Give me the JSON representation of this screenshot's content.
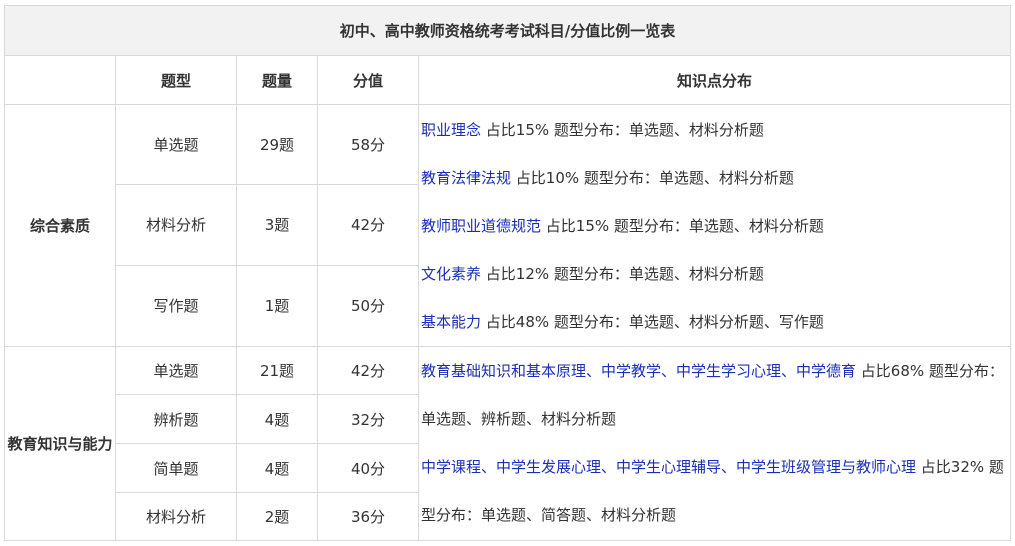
{
  "table": {
    "title": "初中、高中教师资格统考考试科目/分值比例一览表",
    "headers": [
      "",
      "题型",
      "题量",
      "分值",
      "知识点分布"
    ],
    "groups": [
      {
        "name": "综合素质",
        "rows": [
          {
            "type": "单选题",
            "count": "29题",
            "score": "58分"
          },
          {
            "type": "材料分析",
            "count": "3题",
            "score": "42分"
          },
          {
            "type": "写作题",
            "count": "1题",
            "score": "50分"
          }
        ],
        "knowledge": [
          {
            "link": "职业理念",
            "rest": " 占比15% 题型分布：单选题、材料分析题"
          },
          {
            "link": "教育法律法规",
            "rest": " 占比10% 题型分布：单选题、材料分析题"
          },
          {
            "link": "教师职业道德规范",
            "rest": " 占比15% 题型分布：单选题、材料分析题"
          },
          {
            "link": "文化素养",
            "rest": " 占比12% 题型分布：单选题、材料分析题"
          },
          {
            "link": "基本能力",
            "rest": " 占比48% 题型分布：单选题、材料分析题、写作题"
          }
        ]
      },
      {
        "name": "教育知识与能力",
        "rows": [
          {
            "type": "单选题",
            "count": "21题",
            "score": "42分"
          },
          {
            "type": "辨析题",
            "count": "4题",
            "score": "32分"
          },
          {
            "type": "简单题",
            "count": "4题",
            "score": "40分"
          },
          {
            "type": "材料分析",
            "count": "2题",
            "score": "36分"
          }
        ],
        "knowledge": [
          {
            "link": "教育基础知识和基本原理、中学教学、中学生学习心理、中学德育",
            "rest": " 占比68% 题型分布：单选题、辨析题、材料分析题"
          },
          {
            "link": "中学课程、中学生发展心理、中学生心理辅导、中学生班级管理与教师心理",
            "rest": " 占比32% 题型分布：单选题、简答题、材料分析题"
          }
        ]
      }
    ]
  }
}
